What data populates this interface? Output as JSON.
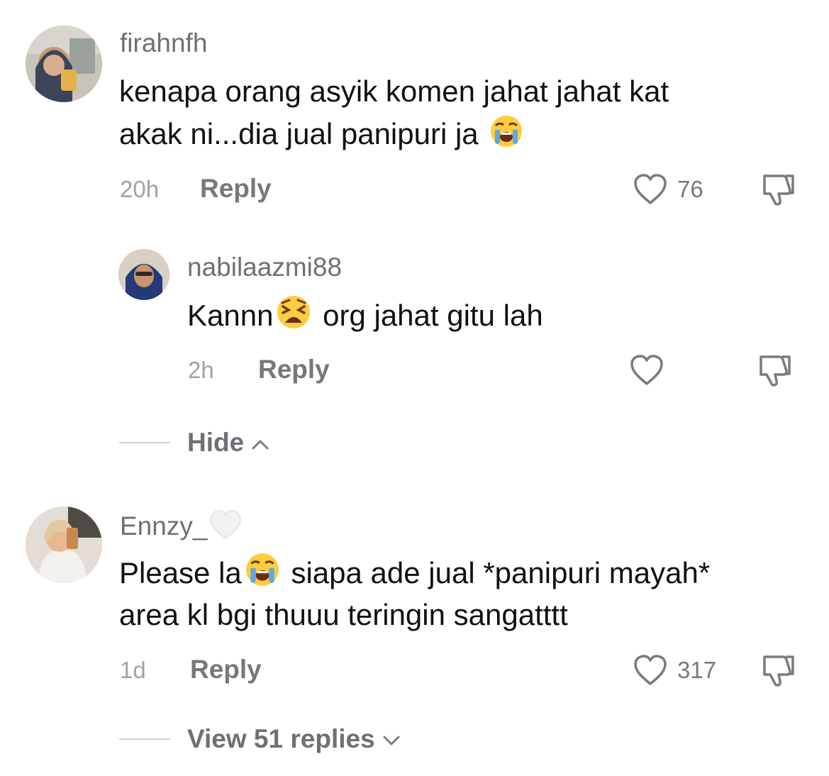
{
  "comments": [
    {
      "username": "firahnfh",
      "text_line1": "kenapa orang asyik komen jahat jahat kat",
      "text_line2": "akak ni...dia jual panipuri ja",
      "text_emoji": "loudly-crying-face",
      "time": "20h",
      "reply_label": "Reply",
      "likes": "76",
      "replies": [
        {
          "username": "nabilaazmi88",
          "text_before_emoji": "Kannn",
          "text_emoji": "weary-face",
          "text_after_emoji": "org jahat gitu lah",
          "time": "2h",
          "reply_label": "Reply"
        }
      ],
      "toggle_label": "Hide"
    },
    {
      "username": "Ennzy_",
      "username_emoji": "white-heart",
      "text_line1_before_emoji": "Please la",
      "text_emoji": "loudly-crying-face",
      "text_line1_after_emoji": "siapa ade jual *panipuri mayah*",
      "text_line2": "area kl bgi thuuu teringin sangatttt",
      "time": "1d",
      "reply_label": "Reply",
      "likes": "317",
      "toggle_label": "View 51 replies"
    }
  ],
  "colors": {
    "background": "#ffffff",
    "username": "#6f6f75",
    "text": "#111111",
    "meta": "#77777c",
    "divider": "#cfcfd2"
  }
}
